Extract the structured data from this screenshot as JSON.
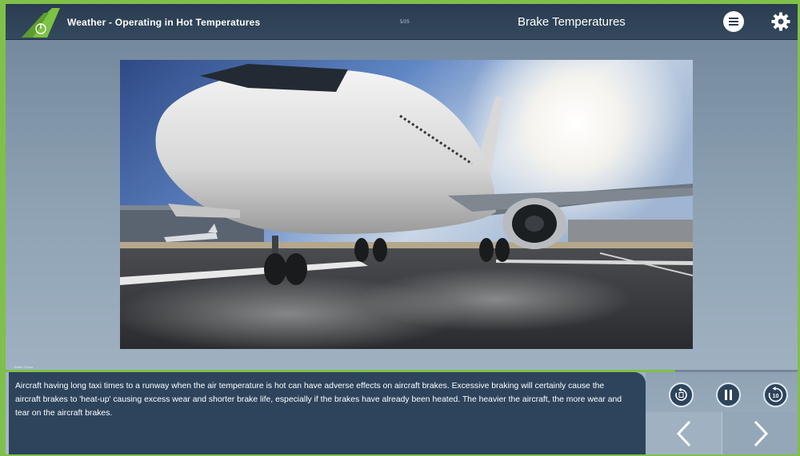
{
  "header": {
    "course_title": "Weather - Operating in Hot Temperatures",
    "page_counter": "5/25",
    "screen_title": "Brake Temperatures"
  },
  "icons": {
    "logo": "plane-tail-logo",
    "menu": "menu-icon",
    "settings": "gear-icon",
    "replay": "replay-icon",
    "pause": "pause-icon",
    "rewind10": "rewind-10-icon",
    "prev": "chevron-left-icon",
    "next": "chevron-right-icon"
  },
  "scene": {
    "caption_tag": "Brake Temps"
  },
  "controls": {
    "rewind_label": "10"
  },
  "progress": {
    "fraction": 0.845
  },
  "body_text": "Aircraft having long taxi times to a runway when the air temperature is hot can have adverse effects on aircraft brakes. Excessive braking will certainly cause the aircraft brakes to 'heat-up' causing excess wear and shorter brake life, especially if the brakes have already been heated. The heavier the aircraft, the more wear and tear on the aircraft brakes.",
  "colors": {
    "accent": "#7cc243",
    "header": "#34495e",
    "panel": "#2d445c"
  }
}
